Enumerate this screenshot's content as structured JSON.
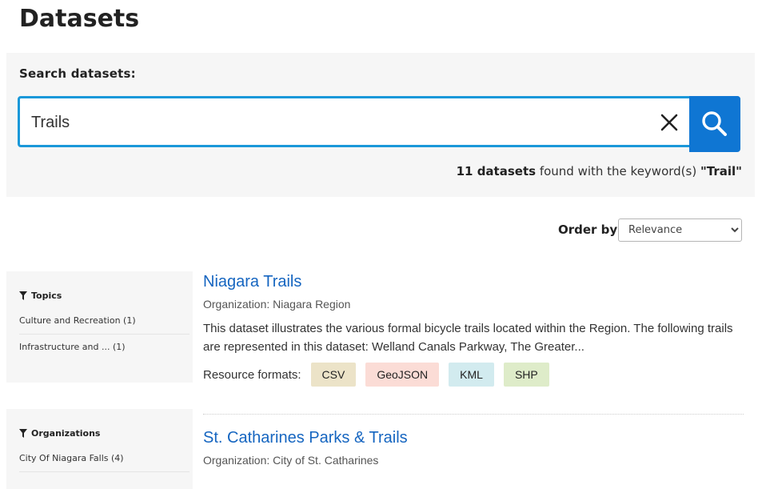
{
  "page": {
    "title": "Datasets"
  },
  "search": {
    "label": "Search datasets:",
    "value": "Trails",
    "results": {
      "count": "11 datasets",
      "mid": " found with the keyword(s) ",
      "keyword": "\"Trail\""
    }
  },
  "order": {
    "label": "Order by:",
    "selected": "Relevance"
  },
  "facets": [
    {
      "title": "Topics",
      "items": [
        "Culture and Recreation (1)",
        "Infrastructure and ... (1)"
      ]
    },
    {
      "title": "Organizations",
      "items": [
        "City Of Niagara Falls (4)"
      ]
    }
  ],
  "datasets": [
    {
      "title": "Niagara Trails",
      "organization": "Organization: Niagara Region",
      "description": "This dataset illustrates the various formal bicycle trails located within the Region. The following trails are represented in this dataset: Welland Canals Parkway, The Greater...",
      "formats_label": "Resource formats:",
      "formats": [
        "CSV",
        "GeoJSON",
        "KML",
        "SHP"
      ]
    },
    {
      "title": "St. Catharines Parks & Trails",
      "organization": "Organization: City of St. Catharines"
    }
  ],
  "colors": {
    "accent": "#1a98d9",
    "search_button": "#0f76d3",
    "link": "#1565c0",
    "badge_csv": "#ece3c8",
    "badge_geojson": "#fbdcd6",
    "badge_kml": "#d2ebef",
    "badge_shp": "#deecc9"
  }
}
